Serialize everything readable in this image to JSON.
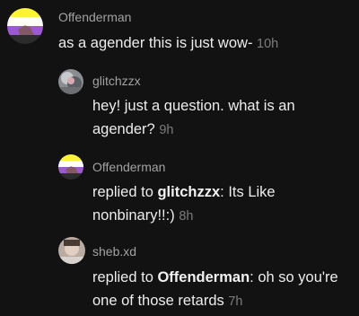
{
  "colors": {
    "background": "#121212",
    "username": "#a2a2a2",
    "text": "#ededed",
    "timestamp": "#7c7c7c",
    "flag_yellow": "#fcf434",
    "flag_white": "#ffffff",
    "flag_purple": "#9c59d1",
    "flag_black": "#2c2c2c"
  },
  "comments": [
    {
      "avatar_icon": "nonbinary-flag-avatar",
      "username": "Offenderman",
      "text": "as a agender this is just wow-",
      "time": "10h"
    },
    {
      "avatar_icon": "photo-avatar",
      "username": "glitchzzx",
      "text": "hey! just a question. what is an agender?",
      "time": "9h"
    },
    {
      "avatar_icon": "nonbinary-flag-avatar",
      "username": "Offenderman",
      "prefix": "replied to ",
      "mention": "glitchzzx",
      "text": ": Its Like nonbinary!!:)",
      "time": "8h"
    },
    {
      "avatar_icon": "photo-avatar",
      "username": "sheb.xd",
      "prefix": "replied to ",
      "mention": "Offenderman",
      "text": ": oh so you're one of those retards",
      "time": "7h"
    }
  ]
}
